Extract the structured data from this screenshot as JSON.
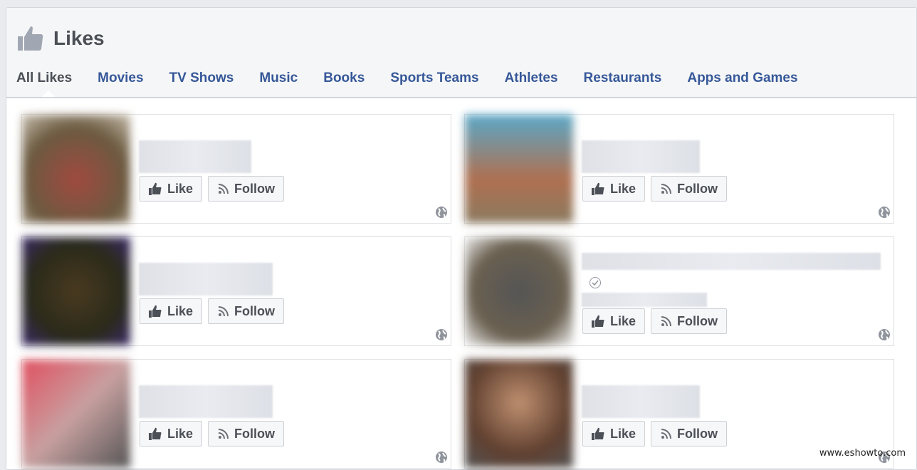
{
  "header": {
    "title": "Likes",
    "icon": "thumbs-up-icon"
  },
  "tabs": [
    {
      "label": "All Likes",
      "active": true
    },
    {
      "label": "Movies"
    },
    {
      "label": "TV Shows"
    },
    {
      "label": "Music"
    },
    {
      "label": "Books"
    },
    {
      "label": "Sports Teams"
    },
    {
      "label": "Athletes"
    },
    {
      "label": "Restaurants"
    },
    {
      "label": "Apps and Games"
    }
  ],
  "cards": [
    {
      "like_label": "Like",
      "follow_label": "Follow",
      "verified": false
    },
    {
      "like_label": "Like",
      "follow_label": "Follow",
      "verified": false
    },
    {
      "like_label": "Like",
      "follow_label": "Follow",
      "verified": false
    },
    {
      "like_label": "Like",
      "follow_label": "Follow",
      "verified": true
    },
    {
      "like_label": "Like",
      "follow_label": "Follow",
      "verified": false
    },
    {
      "like_label": "Like",
      "follow_label": "Follow",
      "verified": false
    }
  ],
  "watermark": "www.eshowto.com"
}
